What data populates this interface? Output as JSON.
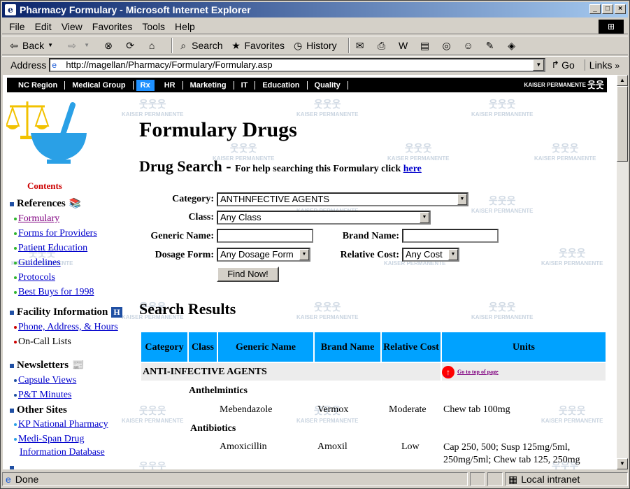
{
  "window": {
    "title": "Pharmacy Formulary - Microsoft Internet Explorer"
  },
  "menu": [
    "File",
    "Edit",
    "View",
    "Favorites",
    "Tools",
    "Help"
  ],
  "toolbar": {
    "back": "Back",
    "search": "Search",
    "favorites": "Favorites",
    "history": "History"
  },
  "address": {
    "label": "Address",
    "url": "http://magellan/Pharmacy/Formulary/Formulary.asp",
    "go": "Go",
    "links": "Links"
  },
  "status": {
    "text": "Done",
    "zone": "Local intranet"
  },
  "nav": {
    "items": [
      "NC Region",
      "Medical Group",
      "Rx",
      "HR",
      "Marketing",
      "IT",
      "Education",
      "Quality"
    ],
    "brand": "KAISER PERMANENTE"
  },
  "watermark": "KAISER PERMANENTE",
  "sidebar": {
    "contents": "Contents",
    "references": {
      "title": "References",
      "items": [
        "Formulary",
        "Forms for Providers",
        "Patient Education",
        "Guidelines",
        "Protocols",
        "Best Buys for 1998"
      ]
    },
    "facility": {
      "title": "Facility Information",
      "items": [
        "Phone, Address, & Hours",
        "On-Call Lists"
      ]
    },
    "newsletters": {
      "title": "Newsletters",
      "items": [
        "Capsule Views",
        "P&T Minutes"
      ]
    },
    "other": {
      "title": "Other Sites",
      "items": [
        "KP National Pharmacy",
        "Medi-Span Drug",
        "Information Database"
      ]
    }
  },
  "main": {
    "title": "Formulary Drugs",
    "search_title": "Drug Search - ",
    "help_text": "For help searching this Formulary click ",
    "help_link": "here",
    "form": {
      "category_label": "Category:",
      "category_value": "ANTHNFECTIVE AGENTS",
      "class_label": "Class:",
      "class_value": "Any Class",
      "generic_label": "Generic Name:",
      "brand_label": "Brand Name:",
      "dosage_label": "Dosage Form:",
      "dosage_value": "Any Dosage Form",
      "cost_label": "Relative Cost:",
      "cost_value": "Any Cost",
      "submit": "Find Now!"
    },
    "results_title": "Search Results",
    "table": {
      "headers": [
        "Category",
        "Class",
        "Generic Name",
        "Brand Name",
        "Relative Cost",
        "Units"
      ],
      "category_row": "ANTI-INFECTIVE AGENTS",
      "to_top": "Go to top of page",
      "groups": [
        {
          "class": "Anthelmintics",
          "rows": [
            {
              "generic": "Mebendazole",
              "brand": "Vermox",
              "cost": "Moderate",
              "units": "Chew tab 100mg"
            }
          ]
        },
        {
          "class": "Antibiotics",
          "rows": [
            {
              "generic": "Amoxicillin",
              "brand": "Amoxil",
              "cost": "Low",
              "units": "Cap 250, 500; Susp 125mg/5ml, 250mg/5ml; Chew tab 125, 250mg"
            }
          ]
        }
      ]
    }
  }
}
